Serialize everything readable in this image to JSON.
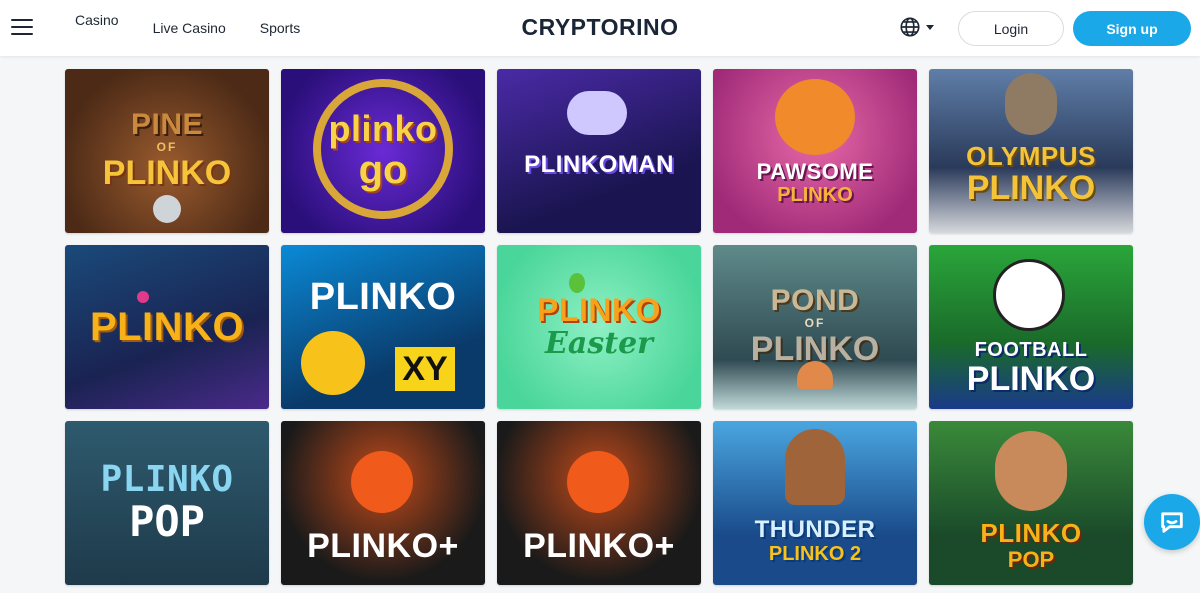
{
  "header": {
    "nav": [
      {
        "label": "Casino",
        "active": true
      },
      {
        "label": "Live Casino",
        "active": false
      },
      {
        "label": "Sports",
        "active": false
      }
    ],
    "logo": "CRYPTORINO",
    "language_icon": "globe-icon",
    "login_label": "Login",
    "signup_label": "Sign up",
    "accent_color": "#1ba8e8"
  },
  "games": [
    {
      "line1": "PINE",
      "small": "OF",
      "line2": "PLINKO"
    },
    {
      "line1": "plinko",
      "line2": "go"
    },
    {
      "line1": "PLINKOMAN",
      "line2": ""
    },
    {
      "line1": "PAWSOME",
      "line2": "PLINKO"
    },
    {
      "line1": "OLYMPUS",
      "line2": "PLINKO"
    },
    {
      "line1": "PLINKO",
      "line2": ""
    },
    {
      "line1": "PLINKO",
      "line2": "XY"
    },
    {
      "line1": "PLINKO",
      "line2": "Easter"
    },
    {
      "line1": "POND",
      "small": "OF",
      "line2": "PLINKO"
    },
    {
      "line1": "FOOTBALL",
      "line2": "PLINKO"
    },
    {
      "line1": "PLINKO",
      "line2": "POP"
    },
    {
      "line1": "PLINKO+",
      "line2": ""
    },
    {
      "line1": "PLINKO+",
      "line2": ""
    },
    {
      "line1": "THUNDER",
      "line2": "PLINKO 2"
    },
    {
      "line1": "PLINKO",
      "line2": "POP"
    }
  ],
  "chat_icon": "chat-bubble-icon"
}
